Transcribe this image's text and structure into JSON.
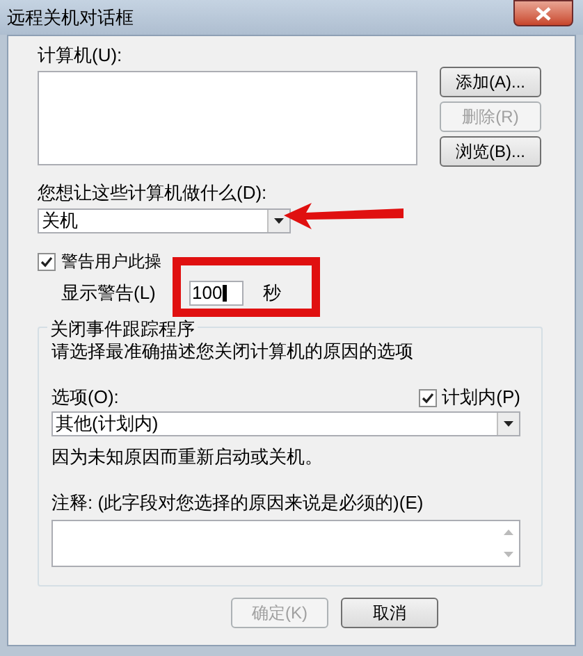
{
  "window": {
    "title": "远程关机对话框"
  },
  "computers": {
    "label": "计算机(U):",
    "buttons": [
      {
        "label": "添加(A)...",
        "disabled": false
      },
      {
        "label": "删除(R)",
        "disabled": true
      },
      {
        "label": "浏览(B)...",
        "disabled": false
      }
    ]
  },
  "action": {
    "label": "您想让这些计算机做什么(D):",
    "value": "关机"
  },
  "warn": {
    "label": "警告用户此操",
    "checked": true
  },
  "display": {
    "label": "显示警告(L)",
    "value": "100",
    "unit": "秒"
  },
  "tracker": {
    "title": "关闭事件跟踪程序",
    "instruction": "请选择最准确描述您关闭计算机的原因的选项",
    "option_label": "选项(O):",
    "planned": {
      "label": "计划内(P)",
      "checked": true
    },
    "option_value": "其他(计划内)",
    "description": "因为未知原因而重新启动或关机。",
    "comment_label": "注释: (此字段对您选择的原因来说是必须的)(E)"
  },
  "buttons": [
    {
      "label": "确定(K)",
      "disabled": true
    },
    {
      "label": "取消",
      "disabled": false
    }
  ]
}
